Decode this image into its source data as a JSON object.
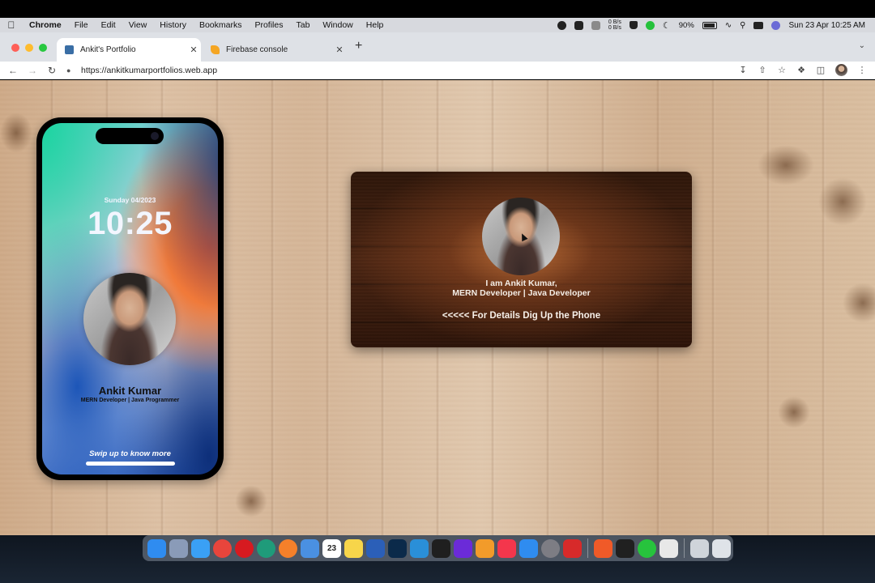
{
  "menubar": {
    "items": [
      "Chrome",
      "File",
      "Edit",
      "View",
      "History",
      "Bookmarks",
      "Profiles",
      "Tab",
      "Window",
      "Help"
    ],
    "net_up": "0 B/s",
    "net_down": "0 B/s",
    "battery": "90%",
    "datetime": "Sun 23 Apr  10:25 AM"
  },
  "browser": {
    "tabs": [
      {
        "title": "Ankit's Portfolio",
        "active": true,
        "favicon_color": "#3a6ea5"
      },
      {
        "title": "Firebase console",
        "active": false,
        "favicon_color": "#f5a623"
      }
    ],
    "url": "https://ankitkumarportfolios.web.app"
  },
  "phone": {
    "date": "Sunday 04/2023",
    "time": "10:25",
    "name": "Ankit Kumar",
    "role": "MERN Developer | Java Programmer",
    "swipe_text": "Swip up to know more"
  },
  "card": {
    "line1": "I am Ankit Kumar,",
    "line2": "MERN Developer | Java Developer",
    "cta": "<<<<< For Details Dig Up the Phone"
  },
  "dock": {
    "calendar_day": "23",
    "apps": [
      {
        "name": "finder-icon",
        "color": "#2f8cf0"
      },
      {
        "name": "launchpad-icon",
        "color": "#8a9bb8"
      },
      {
        "name": "safari-icon",
        "color": "#3aa0f5"
      },
      {
        "name": "chrome-icon",
        "color": "#e8453c"
      },
      {
        "name": "opera-icon",
        "color": "#d71a20"
      },
      {
        "name": "edge-icon",
        "color": "#1f9b7a"
      },
      {
        "name": "firefox-icon",
        "color": "#f5802a"
      },
      {
        "name": "mail-icon",
        "color": "#4a90e2"
      },
      {
        "name": "calendar-icon",
        "color": "#ffffff"
      },
      {
        "name": "notes-icon",
        "color": "#f7d54a"
      },
      {
        "name": "word-icon",
        "color": "#2b5fb8"
      },
      {
        "name": "photoshop-icon",
        "color": "#0b2a4a"
      },
      {
        "name": "vscode-icon",
        "color": "#2a8fd8"
      },
      {
        "name": "pycharm-icon",
        "color": "#1f1f1f"
      },
      {
        "name": "intellij-icon",
        "color": "#6b2bd8"
      },
      {
        "name": "sublime-icon",
        "color": "#f29b2a"
      },
      {
        "name": "music-icon",
        "color": "#f4364c"
      },
      {
        "name": "app-store-icon",
        "color": "#2f8cf0"
      },
      {
        "name": "system-settings-icon",
        "color": "#7d7d84"
      },
      {
        "name": "acrobat-icon",
        "color": "#d72a2a"
      },
      {
        "name": "brave-icon",
        "color": "#f05a28"
      },
      {
        "name": "terminal-icon",
        "color": "#202020"
      },
      {
        "name": "whatsapp-icon",
        "color": "#27c33d"
      },
      {
        "name": "gift-icon",
        "color": "#e8e8e8"
      },
      {
        "name": "archive-icon",
        "color": "#cfd4da"
      },
      {
        "name": "trash-icon",
        "color": "#dfe3e8"
      }
    ]
  }
}
